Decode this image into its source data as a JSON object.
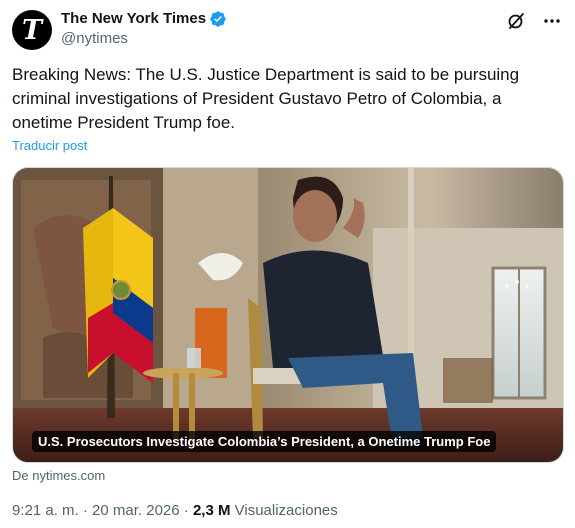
{
  "account": {
    "display_name": "The New York Times",
    "handle": "@nytimes",
    "avatar_glyph": "T"
  },
  "tweet": {
    "text": "Breaking News: The U.S. Justice Department is said to be pursuing criminal investigations of President Gustavo Petro of Colombia, a onetime President Trump foe.",
    "translate_label": "Traducir post"
  },
  "card": {
    "caption": "U.S. Prosecutors Investigate Colombia’s President, a Onetime Trump Foe",
    "source": "De nytimes.com"
  },
  "meta": {
    "time": "9:21 a. m.",
    "separator": " · ",
    "date": "20 mar. 2026",
    "views_count": "2,3 M",
    "views_label": " Visualizaciones"
  },
  "colors": {
    "accent": "#1d9bf0",
    "text": "#0f1419",
    "secondary": "#536471"
  },
  "icons": [
    "verified-badge-icon",
    "grok-icon",
    "more-icon"
  ]
}
